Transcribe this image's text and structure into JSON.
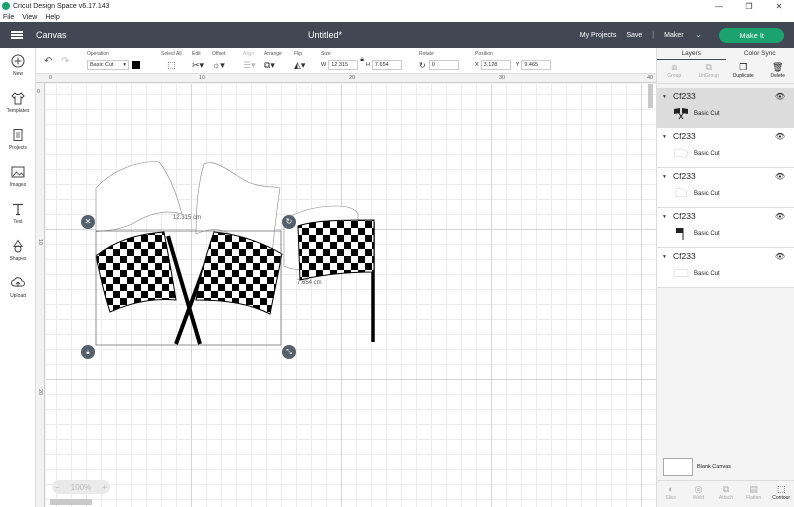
{
  "window": {
    "title": "Cricut Design Space  v6.17.143",
    "controls": [
      "—",
      "❐",
      "✕"
    ]
  },
  "menu": [
    "File",
    "View",
    "Help"
  ],
  "header": {
    "section": "Canvas",
    "doc_title": "Untitled*",
    "my_projects": "My Projects",
    "save": "Save",
    "separator": "|",
    "machine": "Maker",
    "make_it": "Make It"
  },
  "toolbar": {
    "operation_label": "Operation",
    "operation_value": "Basic Cut",
    "select_all": "Select All",
    "edit": "Edit",
    "offset": "Offset",
    "align": "Align",
    "arrange": "Arrange",
    "flip": "Flip",
    "size": "Size",
    "w_label": "W",
    "w_value": "12.315",
    "h_label": "H",
    "h_value": "7.654",
    "rotate": "Rotate",
    "rotate_value": "0",
    "position": "Position",
    "x_label": "X",
    "x_value": "3.128",
    "y_label": "Y",
    "y_value": "9.465"
  },
  "leftbar": [
    {
      "label": "New",
      "icon": "plus-icon"
    },
    {
      "label": "Templates",
      "icon": "shirt-icon"
    },
    {
      "label": "Projects",
      "icon": "projects-icon"
    },
    {
      "label": "Images",
      "icon": "image-icon"
    },
    {
      "label": "Text",
      "icon": "text-icon"
    },
    {
      "label": "Shapes",
      "icon": "shapes-icon"
    },
    {
      "label": "Upload",
      "icon": "upload-icon"
    }
  ],
  "rulers": {
    "top": [
      "0",
      "10",
      "20",
      "30",
      "40"
    ],
    "left": [
      "0",
      "10",
      "20"
    ]
  },
  "canvas": {
    "width_label": "12.315 cm",
    "height_label": "7.654 cm",
    "zoom": "100%"
  },
  "panel": {
    "tab_layers": "Layers",
    "tab_color_sync": "Color Sync",
    "actions": [
      {
        "label": "Group",
        "enabled": false
      },
      {
        "label": "UnGroup",
        "enabled": false
      },
      {
        "label": "Duplicate",
        "enabled": true
      },
      {
        "label": "Delete",
        "enabled": true
      }
    ],
    "layers": [
      {
        "name": "Cf233",
        "type": "Basic Cut",
        "selected": true
      },
      {
        "name": "Cf233",
        "type": "Basic Cut",
        "selected": false
      },
      {
        "name": "Cf233",
        "type": "Basic Cut",
        "selected": false
      },
      {
        "name": "Cf233",
        "type": "Basic Cut",
        "selected": false
      },
      {
        "name": "Cf233",
        "type": "Basic Cut",
        "selected": false
      }
    ],
    "blank_canvas": "Blank Canvas",
    "bottom_actions": [
      {
        "label": "Slice",
        "enabled": false
      },
      {
        "label": "Weld",
        "enabled": false
      },
      {
        "label": "Attach",
        "enabled": false
      },
      {
        "label": "Flatten",
        "enabled": false
      },
      {
        "label": "Contour",
        "enabled": true
      }
    ]
  },
  "colors": {
    "header": "#414854",
    "accent": "#1aa36f"
  }
}
